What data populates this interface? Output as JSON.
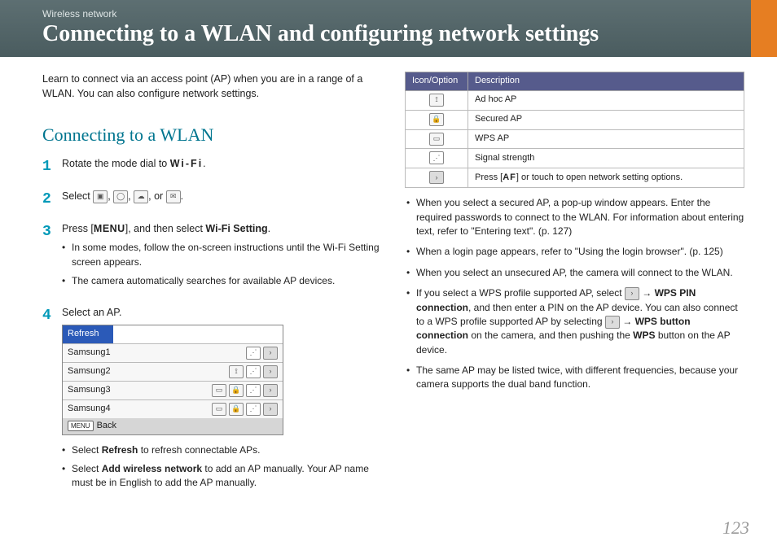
{
  "header": {
    "breadcrumb": "Wireless network",
    "title": "Connecting to a WLAN and configuring network settings"
  },
  "left": {
    "intro": "Learn to connect via an access point (AP) when you are in a range of a WLAN. You can also configure network settings.",
    "h2": "Connecting to a WLAN",
    "step1_pre": "Rotate the mode dial to ",
    "wifi_label": "Wi-Fi",
    "step1_post": ".",
    "step2_pre": "Select ",
    "step2_sep": ", ",
    "step2_sep2": ", ",
    "step2_or": ", or ",
    "step2_post": ".",
    "step3_pre": "Press [",
    "menu_label": "MENU",
    "step3_mid": "], and then select ",
    "step3_bold": "Wi-Fi Setting",
    "step3_post": ".",
    "step3_subs": [
      "In some modes, follow the on-screen instructions until the Wi-Fi Setting screen appears.",
      "The camera automatically searches for available AP devices."
    ],
    "step4": "Select an AP.",
    "ap": {
      "refresh": "Refresh",
      "rows": [
        "Samsung1",
        "Samsung2",
        "Samsung3",
        "Samsung4"
      ],
      "back": "Back",
      "back_menu": "MENU"
    },
    "step4_subs_a_pre": "Select ",
    "step4_subs_a_bold": "Refresh",
    "step4_subs_a_post": " to refresh connectable APs.",
    "step4_subs_b_pre": "Select ",
    "step4_subs_b_bold": "Add wireless network",
    "step4_subs_b_post": " to add an AP manually. Your AP name must be in English to add the AP manually."
  },
  "right": {
    "th1": "Icon/Option",
    "th2": "Description",
    "rows": [
      {
        "desc": "Ad hoc AP"
      },
      {
        "desc": "Secured AP"
      },
      {
        "desc": "WPS AP"
      },
      {
        "desc": "Signal strength"
      },
      {
        "desc_pre": "Press [",
        "af": "AF",
        "desc_post": "] or touch to open network setting options."
      }
    ],
    "bullets": [
      "When you select a secured AP, a pop-up window appears. Enter the required passwords to connect to the WLAN. For information about entering text, refer to \"Entering text\". (p. 127)",
      "When a login page appears, refer to \"Using the login browser\". (p. 125)",
      "When you select an unsecured AP, the camera will connect to the WLAN."
    ],
    "b4_pre": "If you select a WPS profile supported AP, select ",
    "b4_bold1": "WPS PIN connection",
    "b4_mid1": ", and then enter a PIN on the AP device. You can also connect to a WPS profile supported AP by selecting ",
    "b4_bold2": "WPS button connection",
    "b4_mid2": " on the camera, and then pushing the ",
    "b4_bold3": "WPS",
    "b4_end": " button on the AP device.",
    "b5": "The same AP may be listed twice, with different frequencies, because your camera supports the dual band function."
  },
  "arrow": " → ",
  "pagenum": "123"
}
